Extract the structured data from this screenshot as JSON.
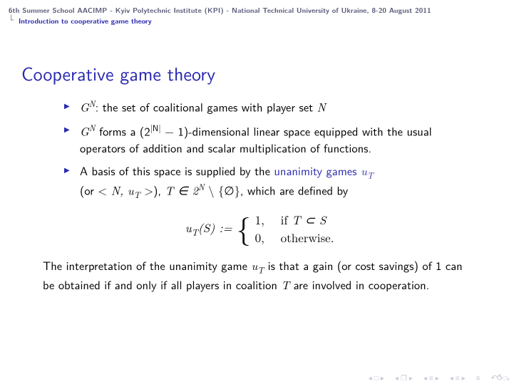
{
  "header": {
    "conference": "6th Summer School AACIMP - Kyiv Polytechnic Institute (KPI) - National Technical University of Ukraine, 8-20 August 2011",
    "section": "Introduction to cooperative game theory"
  },
  "title": "Cooperative game theory",
  "bullets": {
    "b1_pre": "G",
    "b1_sup": "N",
    "b1_post": ": the set of coalitional games with player set ",
    "b1_tail": "N",
    "b2_pre": "G",
    "b2_sup": "N",
    "b2_mid": " forms a (2",
    "b2_exp": "|N|",
    "b2_post": " − 1)-dimensional linear space equipped with the usual operators of addition and scalar multiplication of functions.",
    "b3_pre": "A basis of this space is supplied by the ",
    "b3_link": "unanimity games ",
    "b3_u": "u",
    "b3_T": "T",
    "b3_line2a": "(or < ",
    "b3_line2b": "N, u",
    "b3_line2c": "T",
    "b3_line2d": " >), ",
    "b3_line2e": "T ∈ 2",
    "b3_line2f": "N",
    "b3_line2g": " \\ {∅}, which are defined by"
  },
  "formula": {
    "lhs_u": "u",
    "lhs_T": "T",
    "lhs_S": "(S) := ",
    "case1_val": "1,",
    "case1_cond_pre": "if ",
    "case1_cond": "T ⊂ S",
    "case2_val": "0,",
    "case2_cond": "otherwise."
  },
  "paragraph": {
    "t1": "The interpretation of the unanimity game ",
    "t2": "u",
    "t3": "T",
    "t4": " is that a gain (or cost savings) of 1 can be obtained if and only if all players in coalition ",
    "t5": "T",
    "t6": " are involved in cooperation."
  },
  "nav": {
    "left": "◂",
    "right": "▸",
    "doc": "❐",
    "eq": "≡",
    "undo": "↶⥀⤼"
  }
}
